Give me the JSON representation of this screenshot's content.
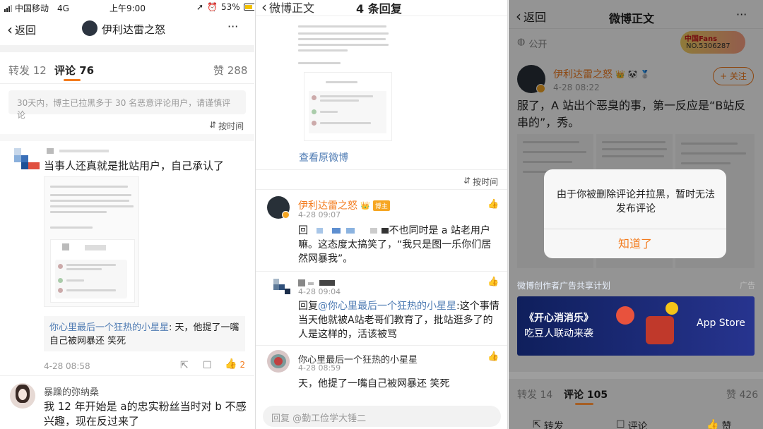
{
  "p1": {
    "status": {
      "carrier": "中国移动",
      "net": "4G",
      "time": "上午9:00",
      "battery": "53%"
    },
    "nav": {
      "back": "返回",
      "title": "伊利达雷之怒",
      "more": "···"
    },
    "tabs": {
      "repost": "转发 12",
      "comment": "评论 76",
      "like": "赞 288"
    },
    "notice": "30天内，博主已拉黑多于 30 名恶意评论用户，请谨慎评论",
    "sort": "按时间",
    "comment1": {
      "text": "当事人还真就是批站用户，自己承认了",
      "quote_user": "你心里最后一个狂热的小星星",
      "quote_text": ": 天，他提了一嘴自己被网暴还 笑死",
      "time": "4-28 08:58",
      "likes": "2"
    },
    "comment2": {
      "user": "暴躁的弥纳桑",
      "text": "我 12 年开始是 a的忠实粉丝当时对 b 不感兴趣，现在反过来了"
    }
  },
  "p2": {
    "nav": {
      "title": "4 条回复",
      "back_label": "微博正文"
    },
    "view_original": "查看原微博",
    "sort": "按时间",
    "reply1": {
      "user": "伊利达雷之怒",
      "badge": "博主",
      "time": "4-28 09:07",
      "text_prefix": "回",
      "text": "不也同时是 a 站老用户嘛。这态度太搞笑了，“我只是图一乐你们居然网暴我”。"
    },
    "reply2": {
      "time": "4-28 09:04",
      "prefix": "回复",
      "mention": "@你心里最后一个狂热的小星星",
      "text": ":这个事情当天他就被A站老哥们教育了，批站逛多了的人是这样的，活该被骂"
    },
    "reply3": {
      "user": "你心里最后一个狂热的小星星",
      "time": "4-28 08:59",
      "text": "天，他提了一嘴自己被网暴还 笑死"
    },
    "input_placeholder": "回复 @勤工俭学大锤二"
  },
  "p3": {
    "nav": {
      "back": "返回",
      "title": "微博正文",
      "more": "···"
    },
    "public": "公开",
    "stamp": "NO.5306287",
    "stamp_top": "中国Fans",
    "post": {
      "user": "伊利达雷之怒",
      "time": "4-28 08:22",
      "follow": "+ 关注",
      "text": "服了，A 站出个恶臭的事，第一反应是“B站反串的”，秀。"
    },
    "dialog": {
      "message": "由于你被删除评论并拉黑，暂时无法发布评论",
      "button": "知道了"
    },
    "ad": {
      "label": "微博创作者广告共享计划",
      "tag": "广告",
      "title": "《开心消消乐》",
      "subtitle": "吃豆人联动来袭",
      "store": "App Store"
    },
    "tabs": {
      "repost": "转发 14",
      "comment": "评论 105",
      "like": "赞 426"
    },
    "actions": {
      "repost": "转发",
      "comment": "评论",
      "like": "赞"
    }
  }
}
